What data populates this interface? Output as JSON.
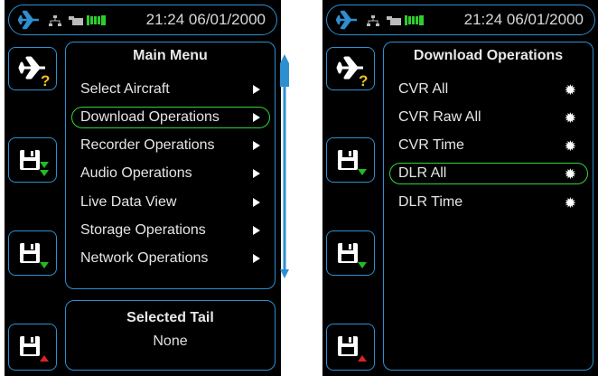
{
  "colors": {
    "frame_blue": "#2e8fd0",
    "selection_green": "#33d33a",
    "battery_green": "#2ecc2e",
    "arrow_green": "#22bb22",
    "arrow_red": "#dd2222",
    "question_yellow": "#f0c020"
  },
  "left_screen": {
    "status": {
      "time": "21:24 06/01/2000",
      "icons": [
        "plane-icon",
        "network-icon",
        "usb-icon",
        "battery-icon"
      ]
    },
    "side_buttons": [
      {
        "name": "select-aircraft-help-button",
        "icon": "plane-question-icon"
      },
      {
        "name": "save-down-button-1",
        "icon": "floppy-download-icon"
      },
      {
        "name": "save-down-button-2",
        "icon": "floppy-download-icon"
      },
      {
        "name": "save-up-button",
        "icon": "floppy-upload-icon"
      }
    ],
    "main_menu": {
      "title": "Main Menu",
      "items": [
        {
          "label": "Select Aircraft",
          "selected": false
        },
        {
          "label": "Download Operations",
          "selected": true
        },
        {
          "label": "Recorder Operations",
          "selected": false
        },
        {
          "label": "Audio Operations",
          "selected": false
        },
        {
          "label": "Live Data View",
          "selected": false
        },
        {
          "label": "Storage Operations",
          "selected": false
        },
        {
          "label": "Network Operations",
          "selected": false
        }
      ]
    },
    "selected_tail": {
      "title": "Selected Tail",
      "value": "None"
    }
  },
  "right_screen": {
    "status": {
      "time": "21:24 06/01/2000"
    },
    "download_menu": {
      "title": "Download Operations",
      "items": [
        {
          "label": "CVR All",
          "selected": false
        },
        {
          "label": "CVR Raw All",
          "selected": false
        },
        {
          "label": "CVR Time",
          "selected": false
        },
        {
          "label": "DLR All",
          "selected": true
        },
        {
          "label": "DLR Time",
          "selected": false
        }
      ]
    }
  }
}
